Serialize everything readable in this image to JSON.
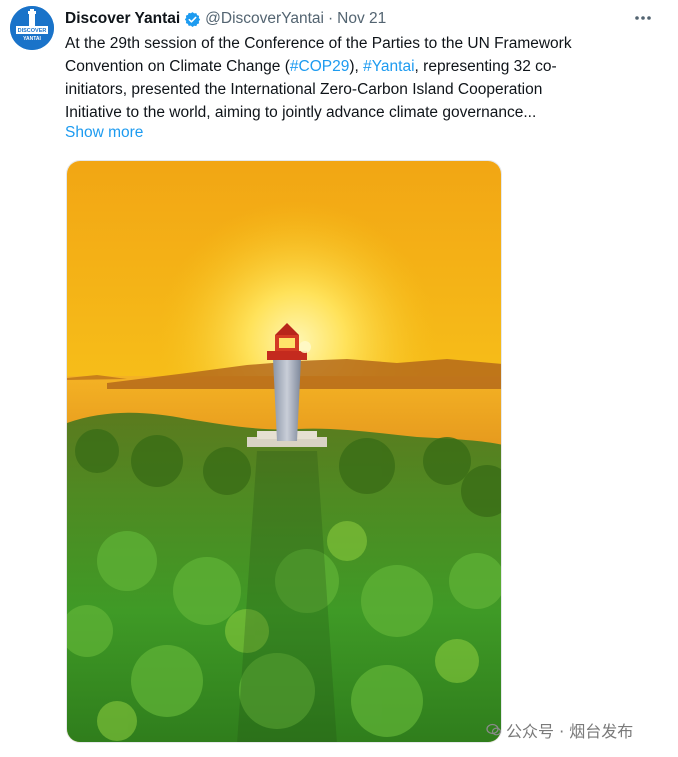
{
  "account": {
    "display_name": "Discover Yantai",
    "handle": "@DiscoverYantai",
    "separator": "·",
    "date": "Nov 21",
    "avatar_text_line1": "DISCOVER",
    "avatar_text_line2": "YANTAI",
    "verified": true
  },
  "tweet": {
    "lines": [
      [
        "At the 29th session of the Conference of the Parties to the UN Framework"
      ],
      [
        "Convention on Climate Change (",
        "#COP29",
        "), ",
        "#Yantai",
        ", representing 32 co-"
      ],
      [
        "initiators, presented the International Zero-Carbon Island Cooperation"
      ],
      [
        "Initiative to the world, aiming to jointly advance climate governance..."
      ]
    ],
    "show_more": "Show more"
  },
  "media": {
    "description_icon": "lighthouse-photo"
  },
  "watermark": {
    "text": "公众号 · 烟台发布"
  },
  "colors": {
    "link": "#1d9bf0",
    "secondary_text": "#536471",
    "verified_badge": "#1d9bf0",
    "avatar_bg": "#1a73c9"
  }
}
